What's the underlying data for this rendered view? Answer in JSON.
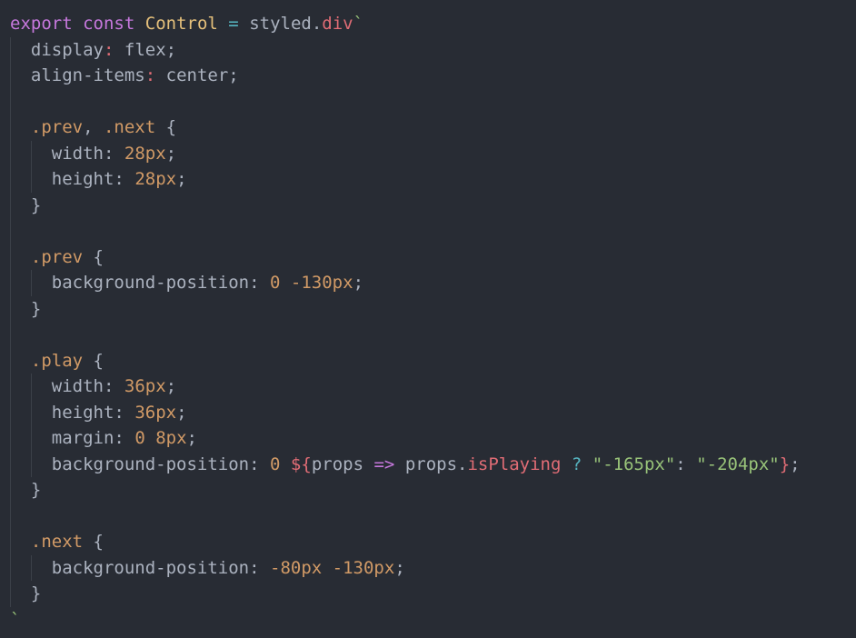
{
  "colors": {
    "background": "#282c34",
    "keyword": "#c678dd",
    "class_name": "#e5c07b",
    "operator": "#56b6c2",
    "tag": "#e06c75",
    "number": "#d19a66",
    "string": "#98c379",
    "text": "#abb2bf"
  },
  "code": {
    "l1": {
      "kw_export": "export",
      "kw_const": "const",
      "name": "Control",
      "eq": "=",
      "obj": "styled",
      "dot": ".",
      "tag": "div",
      "tick": "`"
    },
    "l2": {
      "prop": "display",
      "colon": ":",
      "val": "flex",
      "semi": ";"
    },
    "l3": {
      "prop": "align-items",
      "colon": ":",
      "val": "center",
      "semi": ";"
    },
    "l5": {
      "sel1": ".prev",
      "comma": ", ",
      "sel2": ".next",
      "brace": "{"
    },
    "l6": {
      "prop": "width",
      "colon": ":",
      "val": "28px",
      "semi": ";"
    },
    "l7": {
      "prop": "height",
      "colon": ":",
      "val": "28px",
      "semi": ";"
    },
    "l8": {
      "brace": "}"
    },
    "l10": {
      "sel": ".prev",
      "brace": "{"
    },
    "l11": {
      "prop": "background-position",
      "colon": ":",
      "v1": "0",
      "v2": "-130px",
      "semi": ";"
    },
    "l12": {
      "brace": "}"
    },
    "l14": {
      "sel": ".play",
      "brace": "{"
    },
    "l15": {
      "prop": "width",
      "colon": ":",
      "val": "36px",
      "semi": ";"
    },
    "l16": {
      "prop": "height",
      "colon": ":",
      "val": "36px",
      "semi": ";"
    },
    "l17": {
      "prop": "margin",
      "colon": ":",
      "v1": "0",
      "v2": "8px",
      "semi": ";"
    },
    "l18": {
      "prop": "background-position",
      "colon": ":",
      "v1": "0",
      "interp_open": "${",
      "param": "props",
      "arrow": "=>",
      "obj": "props",
      "dot": ".",
      "member": "isPlaying",
      "q": "?",
      "s1": "\"-165px\"",
      "colon2": ":",
      "s2": "\"-204px\"",
      "interp_close": "}",
      "semi": ";"
    },
    "l19": {
      "brace": "}"
    },
    "l21": {
      "sel": ".next",
      "brace": "{"
    },
    "l22": {
      "prop": "background-position",
      "colon": ":",
      "v1": "-80px",
      "v2": "-130px",
      "semi": ";"
    },
    "l23": {
      "brace": "}"
    },
    "l24": {
      "tick": "`"
    }
  }
}
